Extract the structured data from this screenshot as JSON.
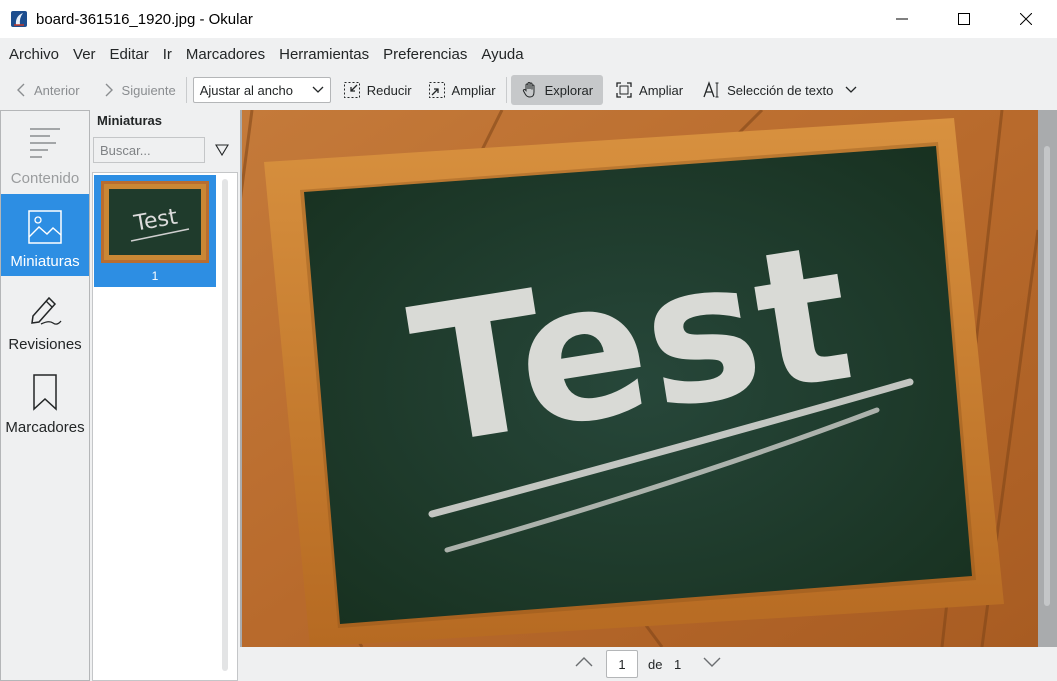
{
  "window": {
    "title": "board-361516_1920.jpg  - Okular"
  },
  "menu": [
    "Archivo",
    "Ver",
    "Editar",
    "Ir",
    "Marcadores",
    "Herramientas",
    "Preferencias",
    "Ayuda"
  ],
  "toolbar": {
    "prev_label": "Anterior",
    "next_label": "Siguiente",
    "zoom_value": "Ajustar al ancho",
    "zoom_out_label": "Reducir",
    "zoom_in_label": "Ampliar",
    "browse_label": "Explorar",
    "zoom_tool_label": "Ampliar",
    "text_select_label": "Selección de texto"
  },
  "sidebar": {
    "tabs": [
      {
        "label": "Contenido",
        "icon": "contents-icon",
        "state": "disabled"
      },
      {
        "label": "Miniaturas",
        "icon": "thumbnails-icon",
        "state": "selected"
      },
      {
        "label": "Revisiones",
        "icon": "reviews-icon",
        "state": "normal"
      },
      {
        "label": "Marcadores",
        "icon": "bookmark-icon",
        "state": "normal"
      }
    ]
  },
  "thumbnails": {
    "title": "Miniaturas",
    "search_placeholder": "Buscar...",
    "items": [
      {
        "label": "1"
      }
    ]
  },
  "document": {
    "chalk_text": "Test"
  },
  "pagination": {
    "current": "1",
    "of_label": "de",
    "total": "1"
  },
  "colors": {
    "accent": "#2d8ee3",
    "chalkboard": "#1f3b2c",
    "frame": "#c27a2c",
    "wood": "#b86d30"
  }
}
